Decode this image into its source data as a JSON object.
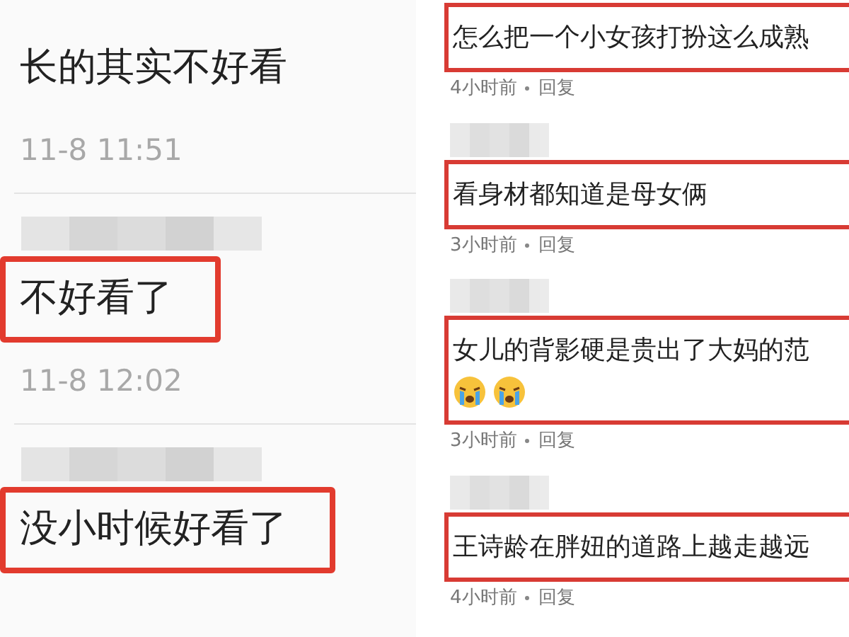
{
  "left_panel": {
    "comments": [
      {
        "text": "长的其实不好看",
        "time": "11-8 11:51",
        "highlighted": false
      },
      {
        "text": "不好看了",
        "time": "11-8 12:02",
        "highlighted": true,
        "name_blurred": true
      },
      {
        "text": "没小时候好看了",
        "highlighted": true,
        "name_blurred": true
      }
    ]
  },
  "right_panel": {
    "comments": [
      {
        "text": "怎么把一个小女孩打扮这么成熟",
        "time": "4小时前",
        "reply": "回复",
        "highlighted": true
      },
      {
        "text": "看身材都知道是母女俩",
        "time": "3小时前",
        "reply": "回复",
        "highlighted": true,
        "name_blurred": true
      },
      {
        "text": "女儿的背影硬是贵出了大妈的范",
        "reactions": [
          {
            "kind": "crying"
          },
          {
            "kind": "crying"
          }
        ],
        "time": "3小时前",
        "reply": "回复",
        "highlighted": true,
        "name_blurred": true
      },
      {
        "text": "王诗龄在胖妞的道路上越走越远",
        "time": "4小时前",
        "reply": "回复",
        "highlighted": true,
        "name_blurred": true
      }
    ]
  }
}
